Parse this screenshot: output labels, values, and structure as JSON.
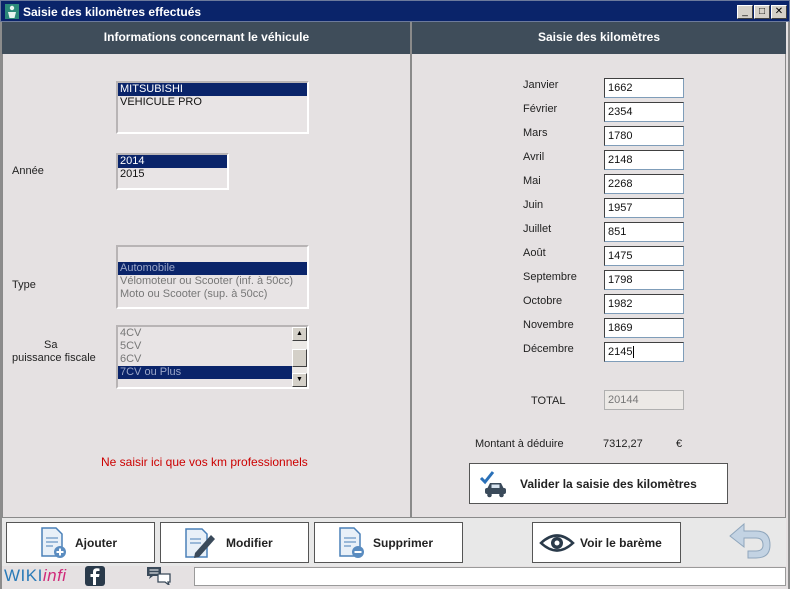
{
  "window": {
    "title": "Saisie des kilomètres effectués",
    "minimize": "_",
    "maximize": "□",
    "close": "✕"
  },
  "left_panel": {
    "header": "Informations concernant le véhicule",
    "vehicle_list": [
      "MITSUBISHI",
      "VEHICULE PRO"
    ],
    "vehicle_selected": 0,
    "year_label": "Année",
    "year_list": [
      "2014",
      "2015"
    ],
    "year_selected": 0,
    "type_label": "Type",
    "type_list": [
      "",
      "Automobile",
      "Vélomoteur ou Scooter (inf. à 50cc)",
      "Moto ou Scooter  (sup. à 50cc)"
    ],
    "type_selected": 1,
    "power_label_1": "Sa",
    "power_label_2": "puissance fiscale",
    "power_list": [
      "4CV",
      "5CV",
      "6CV",
      "7CV ou Plus"
    ],
    "power_selected": 3,
    "warning": "Ne saisir ici que vos km professionnels"
  },
  "right_panel": {
    "header": "Saisie des kilomètres",
    "months": [
      {
        "label": "Janvier",
        "value": "1662"
      },
      {
        "label": "Février",
        "value": "2354"
      },
      {
        "label": "Mars",
        "value": "1780"
      },
      {
        "label": "Avril",
        "value": "2148"
      },
      {
        "label": "Mai",
        "value": "2268"
      },
      {
        "label": "Juin",
        "value": "1957"
      },
      {
        "label": "Juillet",
        "value": "851"
      },
      {
        "label": "Août",
        "value": "1475"
      },
      {
        "label": "Septembre",
        "value": "1798"
      },
      {
        "label": "Octobre",
        "value": "1982"
      },
      {
        "label": "Novembre",
        "value": "1869"
      },
      {
        "label": "Décembre",
        "value": "2145"
      }
    ],
    "total_label": "TOTAL",
    "total_value": "20144",
    "deduct_label": "Montant à déduire",
    "deduct_value": "7312,27",
    "currency": "€",
    "validate_button": "Valider la saisie des kilomètres"
  },
  "toolbar": {
    "add": "Ajouter",
    "edit": "Modifier",
    "delete": "Supprimer",
    "view": "Voir le barème"
  },
  "footer": {
    "brand_part1": "WIKI",
    "brand_part2": "infi"
  },
  "colors": {
    "header_bg": "#3f4d5a",
    "selection": "#0a246a",
    "warning_text": "#cc0000",
    "titlebar": "#0a246a"
  }
}
